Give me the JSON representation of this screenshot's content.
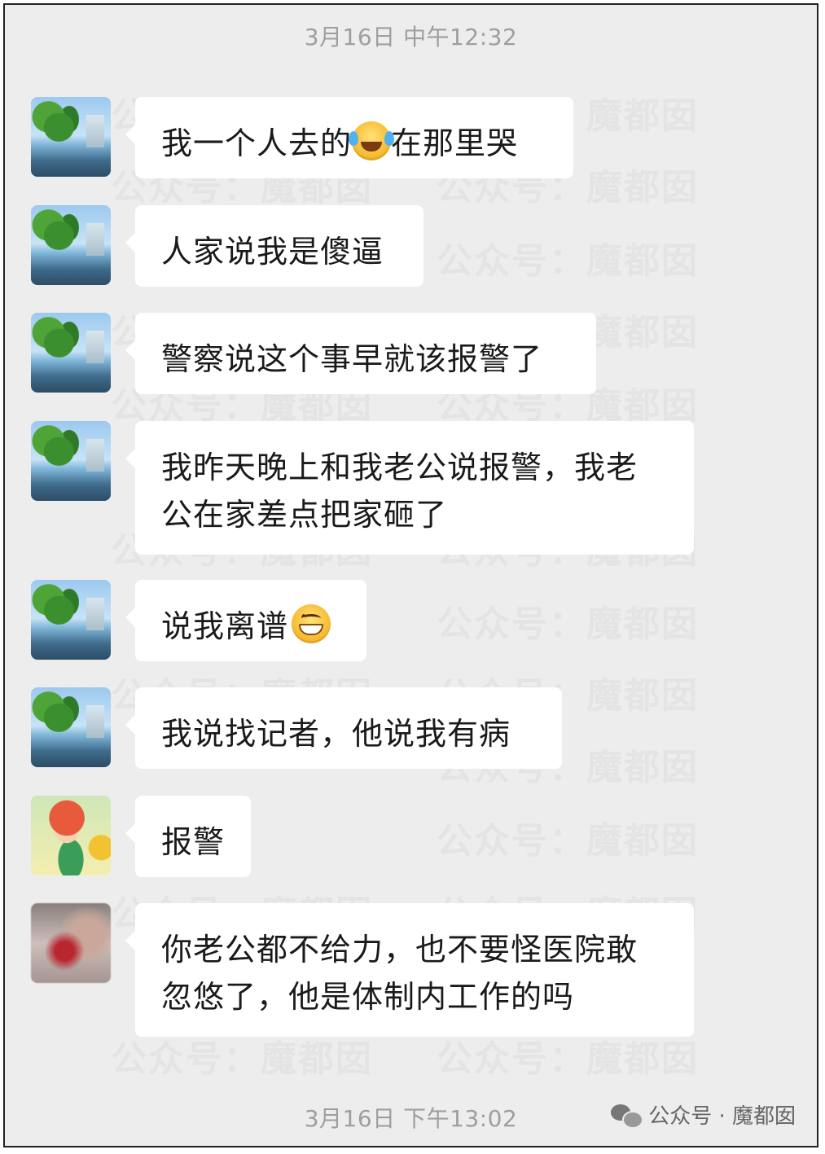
{
  "timestamps": {
    "top": "3月16日 中午12:32",
    "bottom": "3月16日 下午13:02"
  },
  "watermark": {
    "text_a": "公众号：",
    "text_b": "魔都囡"
  },
  "messages": [
    {
      "avatar": "tree",
      "before": "我一个人去的",
      "emoji": "laugh-cry-emoji",
      "after": "在那里哭"
    },
    {
      "avatar": "tree",
      "text": "人家说我是傻逼"
    },
    {
      "avatar": "tree",
      "text": "警察说这个事早就该报警了"
    },
    {
      "avatar": "tree",
      "line1": "我昨天晚上和我老公说报警，我老",
      "line2": "公在家差点把家砸了"
    },
    {
      "avatar": "tree",
      "before": "说我离谱",
      "emoji": "grin-emoji"
    },
    {
      "avatar": "tree",
      "text": "我说找记者，他说我有病"
    },
    {
      "avatar": "cartoon",
      "text": "报警"
    },
    {
      "avatar": "blurred",
      "line1": "你老公都不给力，也不要怪医院敢",
      "line2": "忽悠了，他是体制内工作的吗"
    }
  ],
  "footer": {
    "brand": "公众号 · 魔都囡",
    "icon": "wechat-icon"
  }
}
